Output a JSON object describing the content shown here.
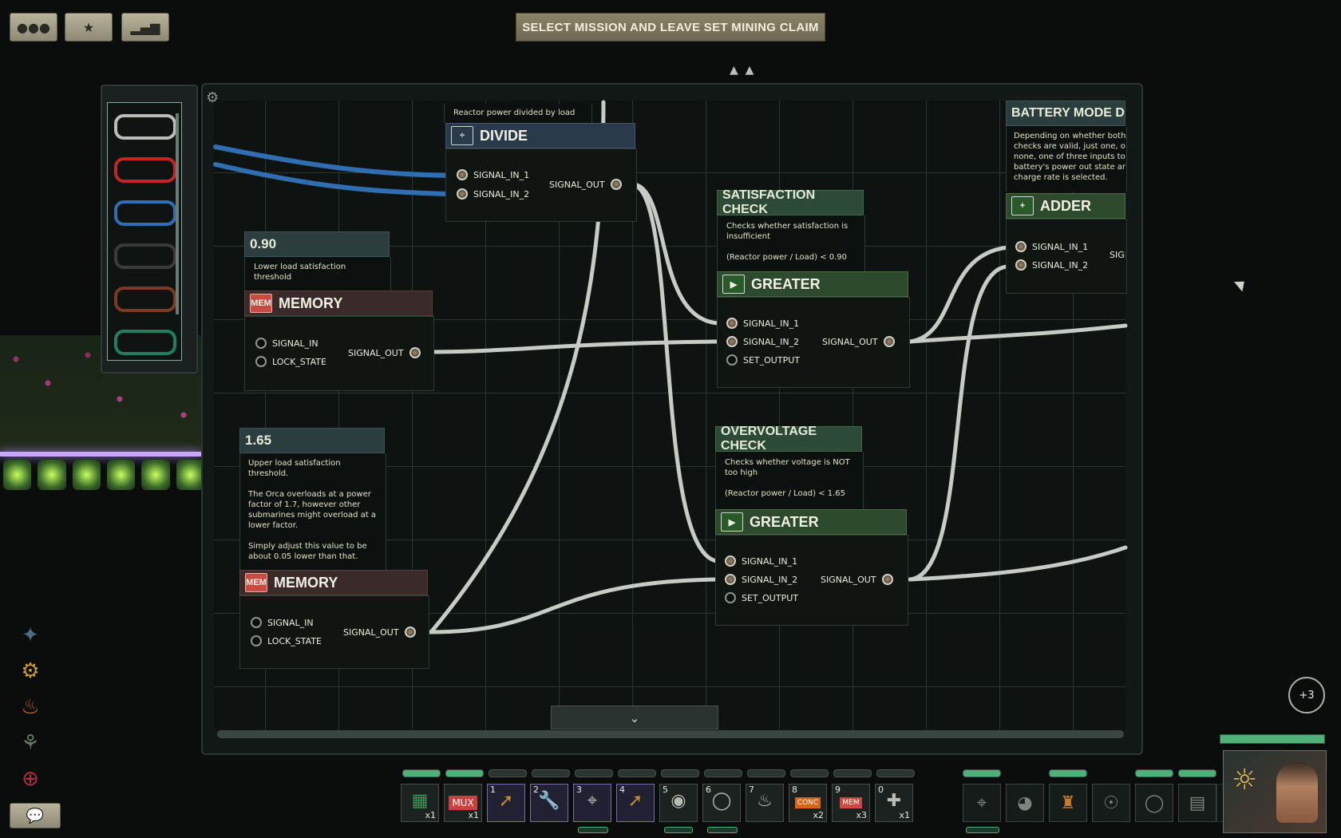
{
  "top_buttons": {
    "crew_icon": "crew-icon",
    "mission_icon": "submarine-icon",
    "stats_icon": "stats-icon"
  },
  "mission_button": "SELECT MISSION AND LEAVE SET MINING CLAIM",
  "wires": [
    {
      "name": "gray-wire",
      "color": "#b9bdb8"
    },
    {
      "name": "red-wire",
      "color": "#c42424"
    },
    {
      "name": "blue-wire",
      "color": "#2f6fb1"
    },
    {
      "name": "black-wire",
      "color": "#3a3a3a"
    },
    {
      "name": "brown-wire",
      "color": "#7a3a26"
    },
    {
      "name": "green-wire",
      "color": "#1e8060"
    }
  ],
  "divide": {
    "desc": "Reactor power divided by load",
    "title": "DIVIDE",
    "in1": "SIGNAL_IN_1",
    "in2": "SIGNAL_IN_2",
    "out": "SIGNAL_OUT"
  },
  "memory1": {
    "value": "0.90",
    "desc": "Lower load satisfaction\nthreshold",
    "title": "MEMORY",
    "in1": "SIGNAL_IN",
    "in2": "LOCK_STATE",
    "out": "SIGNAL_OUT"
  },
  "memory2": {
    "value": "1.65",
    "desc": "Upper load satisfaction\nthreshold.\n\nThe Orca overloads at a power\nfactor of 1.7, however other\nsubmarines might overload at a\nlower factor.\n\nSimply adjust this value to be\nabout 0.05 lower than that.",
    "title": "MEMORY",
    "in1": "SIGNAL_IN",
    "in2": "LOCK_STATE",
    "out": "SIGNAL_OUT"
  },
  "satisfaction": {
    "label": "SATISFACTION CHECK",
    "desc": "Checks whether satisfaction is\ninsufficient\n\n(Reactor power / Load) < 0.90",
    "title": "GREATER",
    "in1": "SIGNAL_IN_1",
    "in2": "SIGNAL_IN_2",
    "in3": "SET_OUTPUT",
    "out": "SIGNAL_OUT"
  },
  "overvoltage": {
    "label": "OVERVOLTAGE CHECK",
    "desc": "Checks whether voltage is NOT\ntoo high\n\n(Reactor power / Load) < 1.65",
    "title": "GREATER",
    "in1": "SIGNAL_IN_1",
    "in2": "SIGNAL_IN_2",
    "in3": "SET_OUTPUT",
    "out": "SIGNAL_OUT"
  },
  "battery": {
    "label": "BATTERY MODE DECI.",
    "desc": "Depending on whether both pr\nchecks are valid, just one, or\nnone, one of three inputs to th\nbattery's power out state and\ncharge rate is selected.",
    "title": "ADDER",
    "in1": "SIGNAL_IN_1",
    "in2": "SIGNAL_IN_2",
    "out_partial": "SIGI"
  },
  "side_icons": [
    "medical-skill-icon",
    "mechanical-skill-icon",
    "fire-icon",
    "husk-icon",
    "health-icon"
  ],
  "badge_more": "+3",
  "hotbar": [
    {
      "num": "",
      "label": "circuit",
      "cnt": "x1",
      "icon": "circuit-board-icon"
    },
    {
      "num": "",
      "label": "MUX",
      "cnt": "x1",
      "icon": "mux-icon"
    },
    {
      "num": "1",
      "label": "",
      "cnt": "",
      "icon": "screwdriver-icon"
    },
    {
      "num": "2",
      "label": "",
      "cnt": "",
      "icon": "wrench-icon"
    },
    {
      "num": "3",
      "label": "",
      "cnt": "",
      "icon": "gun-icon"
    },
    {
      "num": "4",
      "label": "",
      "cnt": "",
      "icon": "screwdriver-icon"
    },
    {
      "num": "5",
      "label": "",
      "cnt": "",
      "icon": "diving-mask-icon"
    },
    {
      "num": "6",
      "label": "",
      "cnt": "",
      "icon": "flashlight-icon"
    },
    {
      "num": "7",
      "label": "",
      "cnt": "",
      "icon": "watering-can-icon"
    },
    {
      "num": "8",
      "label": "CONC",
      "cnt": "x2",
      "icon": "concat-icon"
    },
    {
      "num": "9",
      "label": "MEM",
      "cnt": "x3",
      "icon": "memory-icon"
    },
    {
      "num": "0",
      "label": "",
      "cnt": "x1",
      "icon": "syringe-icon"
    }
  ],
  "equipment": [
    "gun-equip-icon",
    "helmet-icon",
    "suit-icon",
    "headset-icon",
    "goggles-icon",
    "id-card-icon",
    "mask-icon"
  ]
}
